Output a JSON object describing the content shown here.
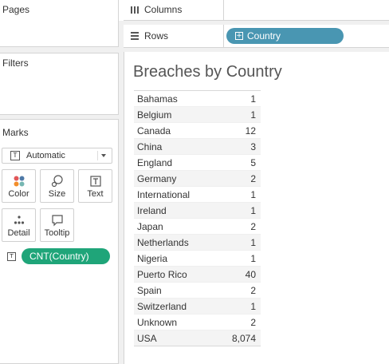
{
  "panels": {
    "pages_title": "Pages",
    "filters_title": "Filters",
    "marks_title": "Marks"
  },
  "marks": {
    "mark_type": "Automatic",
    "buttons": {
      "color": "Color",
      "size": "Size",
      "text": "Text",
      "detail": "Detail",
      "tooltip": "Tooltip"
    },
    "text_field_pill": "CNT(Country)",
    "colors": {
      "pill": "#1fa579"
    }
  },
  "shelves": {
    "columns_label": "Columns",
    "rows_label": "Rows",
    "rows_pill": "Country",
    "colors": {
      "pill": "#4996b2"
    }
  },
  "view": {
    "title": "Breaches by Country"
  },
  "chart_data": {
    "type": "table",
    "title": "Breaches by Country",
    "columns": [
      "Country",
      "CNT(Country)"
    ],
    "rows": [
      {
        "country": "Bahamas",
        "value": "1"
      },
      {
        "country": "Belgium",
        "value": "1"
      },
      {
        "country": "Canada",
        "value": "12"
      },
      {
        "country": "China",
        "value": "3"
      },
      {
        "country": "England",
        "value": "5"
      },
      {
        "country": "Germany",
        "value": "2"
      },
      {
        "country": "International",
        "value": "1"
      },
      {
        "country": "Ireland",
        "value": "1"
      },
      {
        "country": "Japan",
        "value": "2"
      },
      {
        "country": "Netherlands",
        "value": "1"
      },
      {
        "country": "Nigeria",
        "value": "1"
      },
      {
        "country": "Puerto Rico",
        "value": "40"
      },
      {
        "country": "Spain",
        "value": "2"
      },
      {
        "country": "Switzerland",
        "value": "1"
      },
      {
        "country": "Unknown",
        "value": "2"
      },
      {
        "country": "USA",
        "value": "8,074"
      }
    ]
  }
}
